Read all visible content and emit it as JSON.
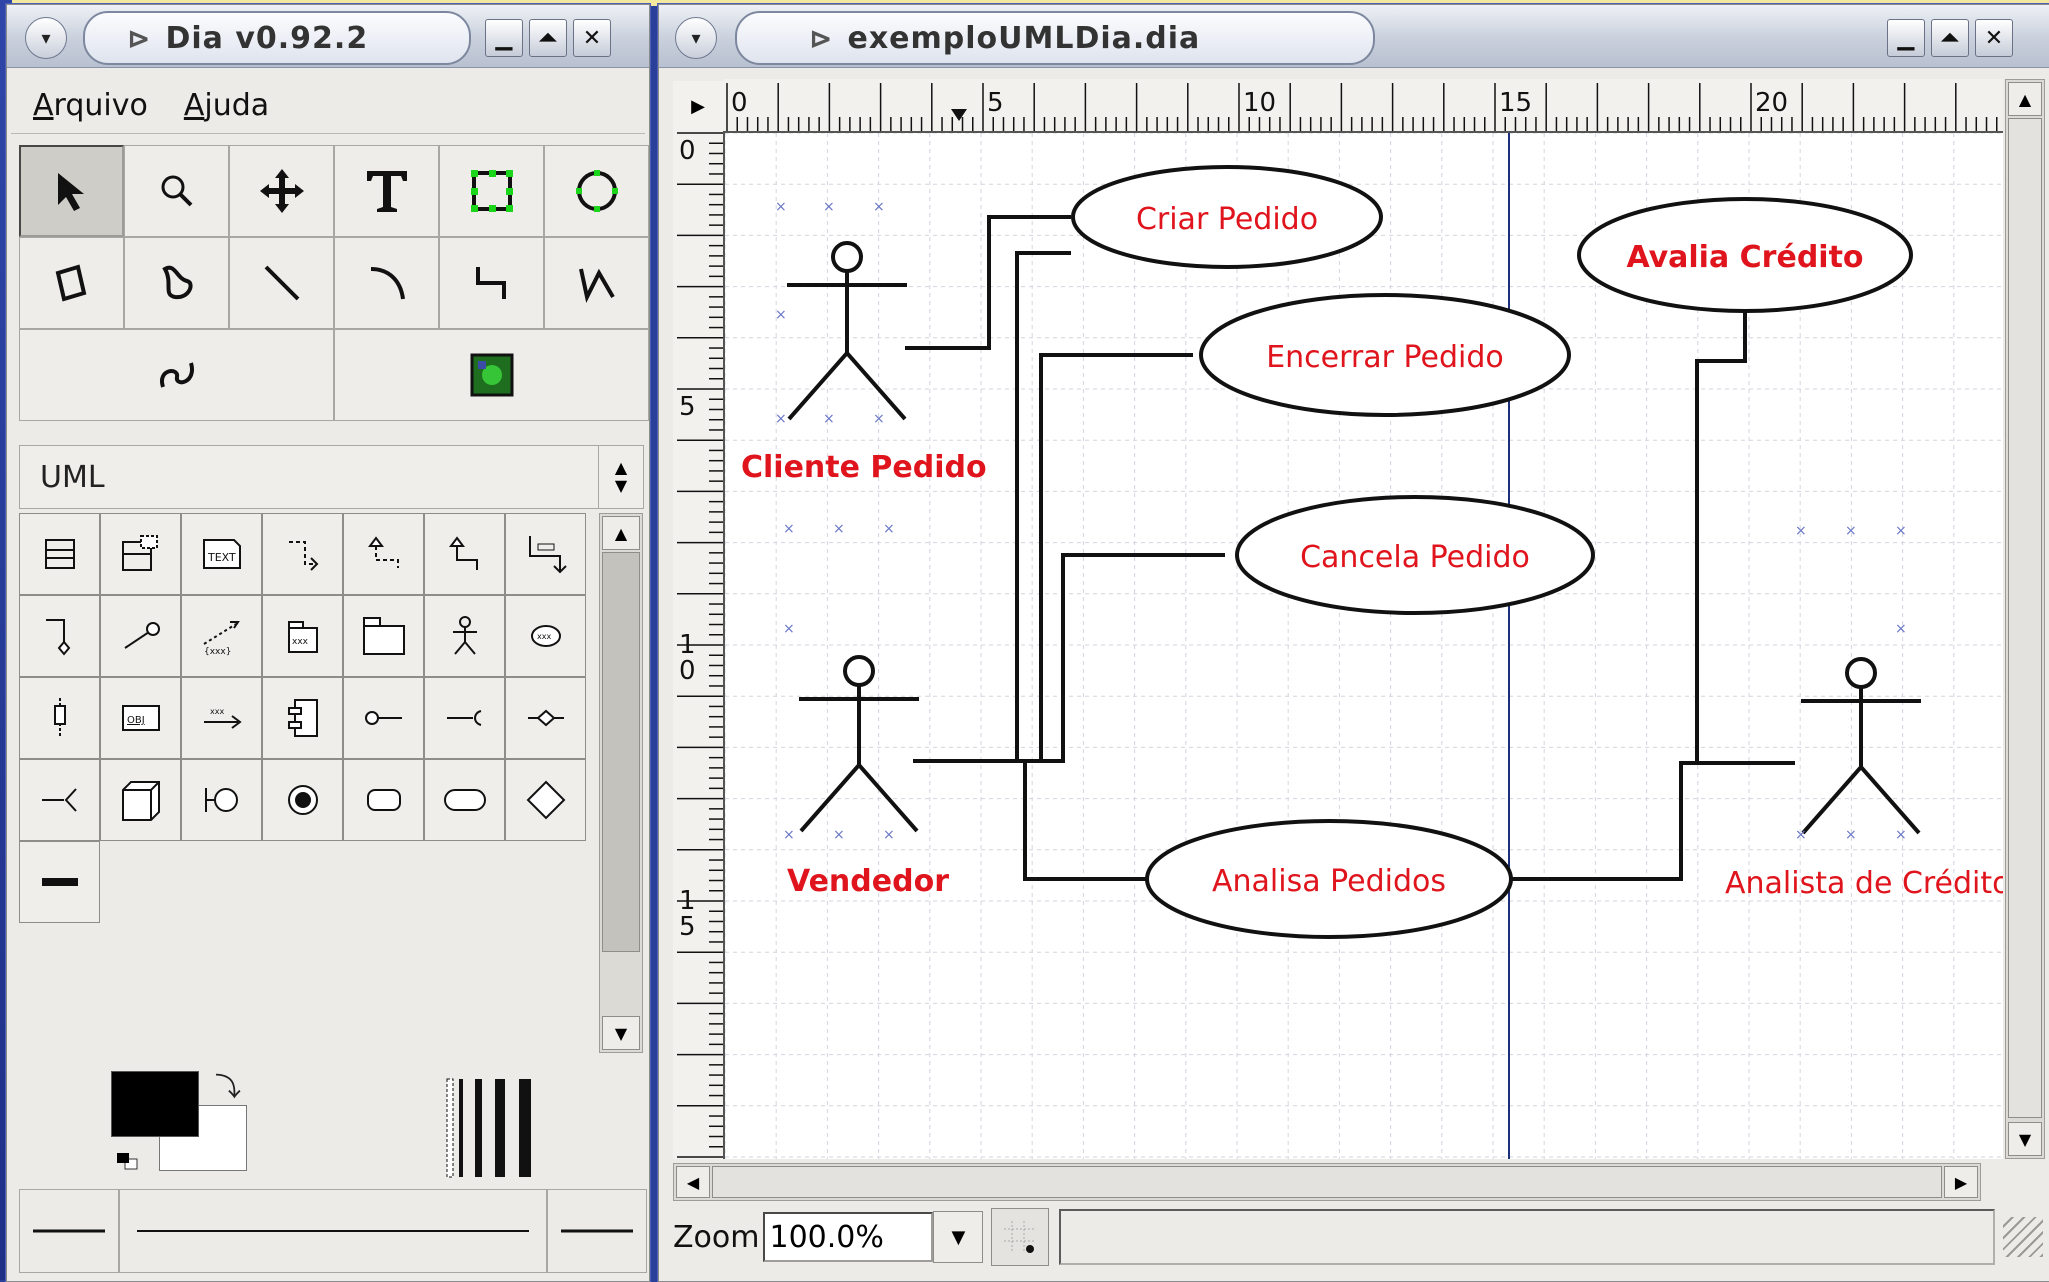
{
  "toolbox": {
    "title": "Dia v0.92.2",
    "menu": [
      {
        "accel": "A",
        "rest": "rquivo"
      },
      {
        "accel": "A",
        "rest": "juda"
      }
    ],
    "sheet": "UML",
    "colors": {
      "foreground": "#000000",
      "background": "#ffffff"
    }
  },
  "diagram": {
    "title": "exemploUMLDia.dia",
    "ruler_h_labels": [
      "0",
      "5",
      "10",
      "15",
      "20"
    ],
    "ruler_v_labels": [
      [
        "0"
      ],
      [
        "5"
      ],
      [
        "1",
        "0"
      ],
      [
        "1",
        "5"
      ]
    ],
    "use_cases": [
      {
        "label": "Criar Pedido"
      },
      {
        "label": "Encerrar Pedido"
      },
      {
        "label": "Cancela Pedido"
      },
      {
        "label": "Analisa Pedidos"
      },
      {
        "label": "Avalia Crédito"
      }
    ],
    "actors": [
      {
        "label": "Cliente Pedido"
      },
      {
        "label": "Vendedor"
      },
      {
        "label": "Analista de Crédito"
      }
    ],
    "zoom_label": "Zoom",
    "zoom_value": "100.0%",
    "text_color": "#e0141c"
  }
}
